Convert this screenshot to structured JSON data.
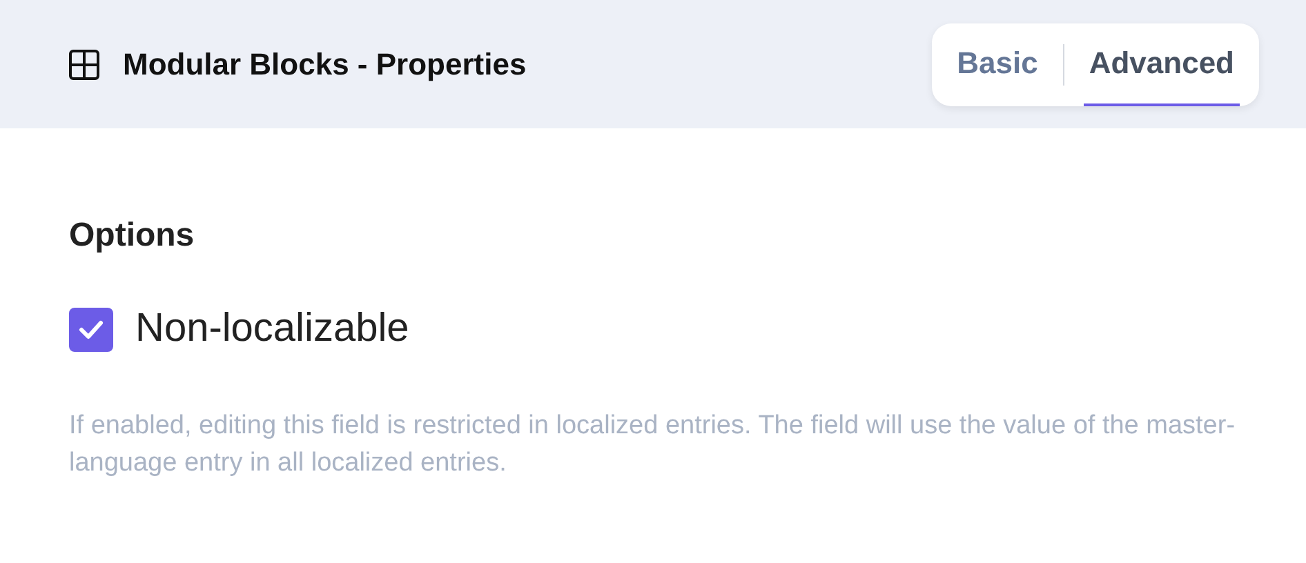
{
  "header": {
    "title": "Modular Blocks - Properties"
  },
  "tabs": [
    {
      "label": "Basic",
      "selected": false
    },
    {
      "label": "Advanced",
      "selected": true
    }
  ],
  "options": {
    "heading": "Options",
    "checkbox": {
      "label": "Non-localizable",
      "checked": true
    },
    "help": "If enabled, editing this field is restricted in localized entries. The field will use the value of the master-language entry in all localized entries."
  }
}
